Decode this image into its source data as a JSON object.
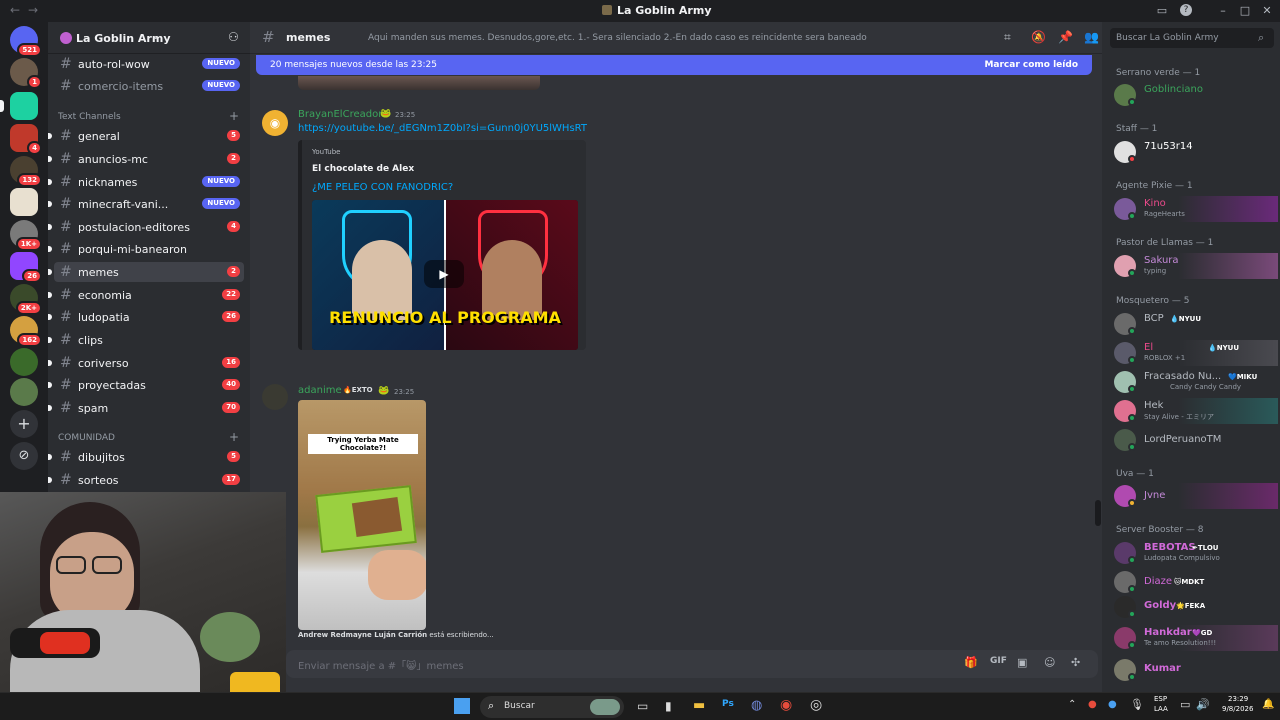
{
  "window": {
    "title": "La Goblin Army"
  },
  "servers": {
    "badges": [
      "521",
      "1",
      "4",
      "132",
      "1K+",
      "26",
      "2K+",
      "162"
    ]
  },
  "guild": {
    "name": "La Goblin Army"
  },
  "channels": {
    "top": [
      {
        "name": "auto-rol-wow",
        "badge": "NUEVO"
      },
      {
        "name": "comercio-items",
        "badge": "NUEVO"
      }
    ],
    "text_category": "Text Channels",
    "text": [
      {
        "name": "general",
        "badge": "5"
      },
      {
        "name": "anuncios-mc",
        "badge": "2"
      },
      {
        "name": "nicknames",
        "badge": "NUEVO"
      },
      {
        "name": "minecraft-vani...",
        "badge": "NUEVO"
      },
      {
        "name": "postulacion-editores",
        "badge": "4"
      },
      {
        "name": "porqui-mi-banearon",
        "badge": ""
      },
      {
        "name": "memes",
        "badge": "2"
      },
      {
        "name": "economia",
        "badge": "22"
      },
      {
        "name": "ludopatia",
        "badge": "26"
      },
      {
        "name": "clips",
        "badge": ""
      },
      {
        "name": "coriverso",
        "badge": "16"
      },
      {
        "name": "proyectadas",
        "badge": "40"
      },
      {
        "name": "spam",
        "badge": "70"
      }
    ],
    "community_category": "COMUNIDAD",
    "community": [
      {
        "name": "dibujitos",
        "badge": "5"
      },
      {
        "name": "sorteos",
        "badge": "17"
      }
    ]
  },
  "chat": {
    "channel": "memes",
    "topic": "Aqui manden sus memes. Desnudos,gore,etc. 1.- Sera silenciado 2.-En dado caso es reincidente sera baneado",
    "new_messages": "20 mensajes nuevos desde las 23:25",
    "mark_read": "Marcar como leído",
    "messages": [
      {
        "author": "BrayanElCreador",
        "time": "23:25",
        "link": "https://youtube.be/_dEGNm1Z0bI?si=Gunn0j0YU5lWHsRT",
        "embed": {
          "provider": "YouTube",
          "author": "El chocolate de Alex",
          "title": "¿ME PELEO CON FANODRIC?",
          "thumb_text": "RENUNCIO AL PROGRAMA"
        }
      },
      {
        "author": "adanime",
        "tag": "EXTO",
        "time": "23:25",
        "image_caption": "Trying Yerba Mate Chocolate?!"
      }
    ],
    "typing": {
      "user": "Andrew Redmayne Luján Carrión",
      "text": "está escribiendo..."
    },
    "composer_placeholder": "Enviar mensaje a #「😸」memes"
  },
  "search": {
    "placeholder": "Buscar La Goblin Army"
  },
  "members": {
    "groups": [
      {
        "header": "Serrano verde — 1",
        "members": [
          {
            "name": "Goblinciano",
            "sub": "",
            "color": "#3ba55c"
          }
        ]
      },
      {
        "header": "Staff — 1",
        "members": [
          {
            "name": "71u53r14",
            "sub": "",
            "color": "#ffffff"
          }
        ]
      },
      {
        "header": "Agente Pixie — 1",
        "members": [
          {
            "name": "Kino",
            "sub": "RageHearts",
            "color": "#e94a8a"
          }
        ]
      },
      {
        "header": "Pastor de Llamas — 1",
        "members": [
          {
            "name": "Sakura",
            "sub": "typing",
            "color": "#c48ad8"
          }
        ]
      },
      {
        "header": "Mosquetero — 5",
        "members": [
          {
            "name": "BCP",
            "sub": "",
            "color": "#b5bac1"
          },
          {
            "name": "El",
            "sub": "ROBLOX +1",
            "color": "#e94a8a"
          },
          {
            "name": "Fracasado Nu...",
            "sub": "Candy Candy Candy",
            "color": "#b5bac1"
          },
          {
            "name": "Hek",
            "sub": "Stay Alive - エミリア",
            "color": "#b5bac1"
          },
          {
            "name": "LordPeruanoTM",
            "sub": "",
            "color": "#b5bac1"
          }
        ]
      },
      {
        "header": "Uva — 1",
        "members": [
          {
            "name": "Jvne",
            "sub": "",
            "color": "#c48ad8"
          }
        ]
      },
      {
        "header": "Server Booster — 8",
        "members": [
          {
            "name": "BEBOTAS",
            "sub": "Ludopata Compulsivo",
            "color": "#d16ad8"
          },
          {
            "name": "Diaze",
            "sub": "",
            "color": "#d16ad8"
          },
          {
            "name": "Goldy",
            "sub": "",
            "color": "#d16ad8"
          },
          {
            "name": "Hankdar",
            "sub": "Te amo Resolution!!!",
            "color": "#d16ad8"
          },
          {
            "name": "Kumar",
            "sub": "",
            "color": "#d16ad8"
          }
        ]
      }
    ],
    "tags": {
      "bcp": "NYUU",
      "el": "NYUU",
      "fracasado": "MIKU",
      "bebotas": "TLOU",
      "diaze": "MDKT",
      "goldy": "FEKA",
      "hankdar": "GD"
    }
  },
  "taskbar": {
    "search": "Buscar",
    "lang": "ESP",
    "lang2": "LAA",
    "time": "23:29",
    "date": "9/8/2026"
  },
  "colors": {
    "accent": "#5865f2",
    "link": "#00a8fc",
    "mention_red": "#f23f43"
  }
}
